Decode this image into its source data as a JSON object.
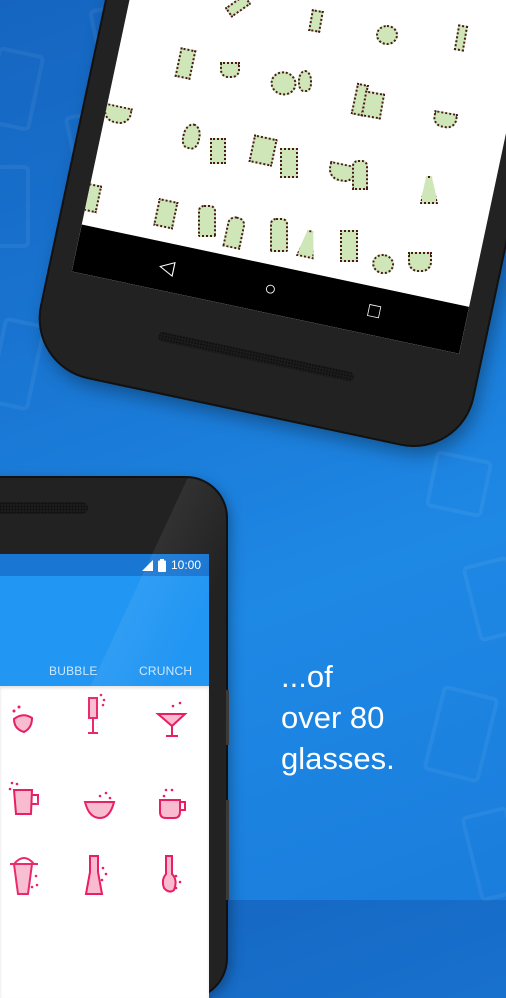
{
  "tagline": {
    "line1": "...of",
    "line2": "over 80",
    "line3": "glasses."
  },
  "top_phone": {
    "nav": {
      "back_glyph": "◁",
      "home_glyph": "○",
      "recents_glyph": "□"
    },
    "glass_fill_color": "#cfe6b8",
    "glasses": [
      "champagne-flute",
      "highball",
      "round-bowl",
      "flute",
      "wine-glass",
      "tulip-glass",
      "tumbler",
      "bowl",
      "pint",
      "pint",
      "shaker",
      "flask",
      "bottle",
      "bottle",
      "carafe",
      "cup",
      "mug"
    ]
  },
  "bottom_phone": {
    "status_bar": {
      "time": "10:00",
      "signal_icon": "signal-icon",
      "battery_icon": "battery-icon"
    },
    "tabs": [
      {
        "label": "BUBBLE"
      },
      {
        "label": "CRUNCH"
      }
    ],
    "accent_color": "#2196f3",
    "icon_color": "#e91e63",
    "glasses": [
      "heart-bowl",
      "flute",
      "martini",
      "beer-mug",
      "bowl",
      "cup",
      "shaker",
      "carafe",
      "decanter"
    ]
  }
}
